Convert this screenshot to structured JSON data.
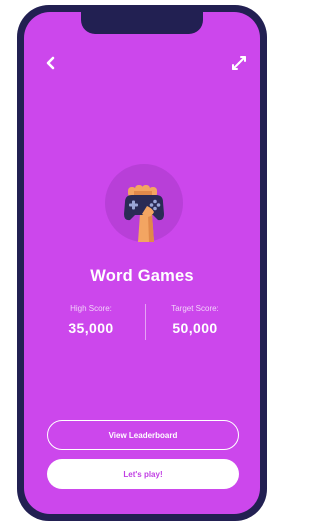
{
  "colors": {
    "phone_frame": "#222052",
    "screen_background": "#cc47ec",
    "hero_circle": "#b83fd8",
    "primary_button_text": "#c13fe4"
  },
  "nav": {
    "back_icon": "chevron-left-icon",
    "swap_icon": "swap-arrows-icon"
  },
  "hero": {
    "icon": "fist-holding-game-controller-icon"
  },
  "game": {
    "title": "Word Games"
  },
  "scores": {
    "high_label": "High Score:",
    "high_value": "35,000",
    "target_label": "Target Score:",
    "target_value": "50,000"
  },
  "actions": {
    "leaderboard_label": "View Leaderboard",
    "play_label": "Let's play!"
  }
}
